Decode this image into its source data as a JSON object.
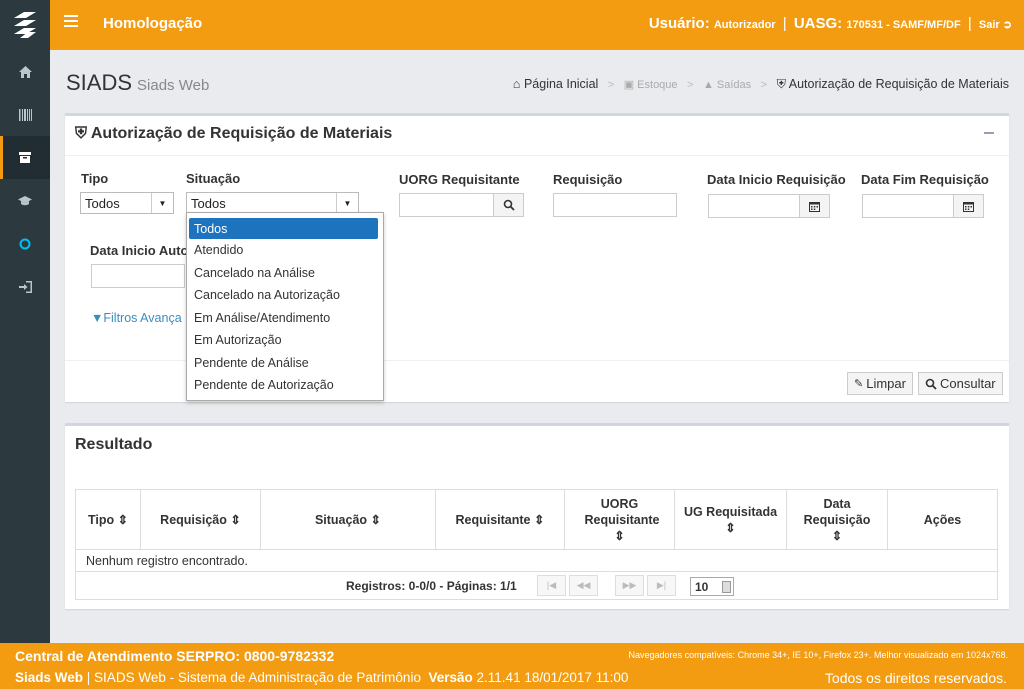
{
  "topbar": {
    "app_title": "Homologação",
    "user_label": "Usuário:",
    "user_name": "Autorizador",
    "uasg_label": "UASG:",
    "uasg_value": "170531 - SAMF/MF/DF",
    "logout": "Sair"
  },
  "sidebar": {
    "items": [
      {
        "icon": "home-icon"
      },
      {
        "icon": "barcode-icon"
      },
      {
        "icon": "archive-icon",
        "active": true
      },
      {
        "icon": "graduation-cap-icon"
      },
      {
        "icon": "circle-icon"
      },
      {
        "icon": "sign-in-icon"
      }
    ]
  },
  "header": {
    "title": "SIADS",
    "subtitle": "Siads Web",
    "breadcrumb": [
      "Página Inicial",
      "Estoque",
      "Saídas",
      "Autorização de Requisição de Materiais"
    ]
  },
  "form": {
    "title": "Autorização de Requisição de Materiais",
    "tipo_label": "Tipo",
    "tipo_value": "Todos",
    "situacao_label": "Situação",
    "situacao_value": "Todos",
    "situacao_options": [
      "Todos",
      "Atendido",
      "Cancelado na Análise",
      "Cancelado na Autorização",
      "Em Análise/Atendimento",
      "Em Autorização",
      "Pendente de Análise",
      "Pendente de Autorização"
    ],
    "uorg_label": "UORG Requisitante",
    "requisicao_label": "Requisição",
    "data_inicio_label": "Data Inicio Requisição",
    "data_fim_label": "Data Fim Requisição",
    "data_inicio_aut_label": "Data Inicio Auto",
    "filtros_link": "Filtros Avança",
    "limpar": "Limpar",
    "consultar": "Consultar"
  },
  "result": {
    "title": "Resultado",
    "columns": [
      "Tipo",
      "Requisição",
      "Situação",
      "Requisitante",
      "UORG Requisitante",
      "UG Requisitada",
      "Data Requisição",
      "Ações"
    ],
    "empty": "Nenhum registro encontrado.",
    "pager_info": "Registros: 0-0/0 - Páginas: 1/1",
    "page_size": "10"
  },
  "footer": {
    "central": "Central de Atendimento SERPRO: 0800-9782332",
    "browsers": "Navegadores compatíveis: Chrome 34+, IE 10+, Firefox 23+. Melhor visualizado em 1024x768.",
    "app_name": "Siads Web",
    "app_desc": "| SIADS Web - Sistema de Administração de Patrimônio",
    "version_label": "Versão",
    "version": "2.11.41 18/01/2017 11:00",
    "rights": "Todos os direitos reservados."
  }
}
